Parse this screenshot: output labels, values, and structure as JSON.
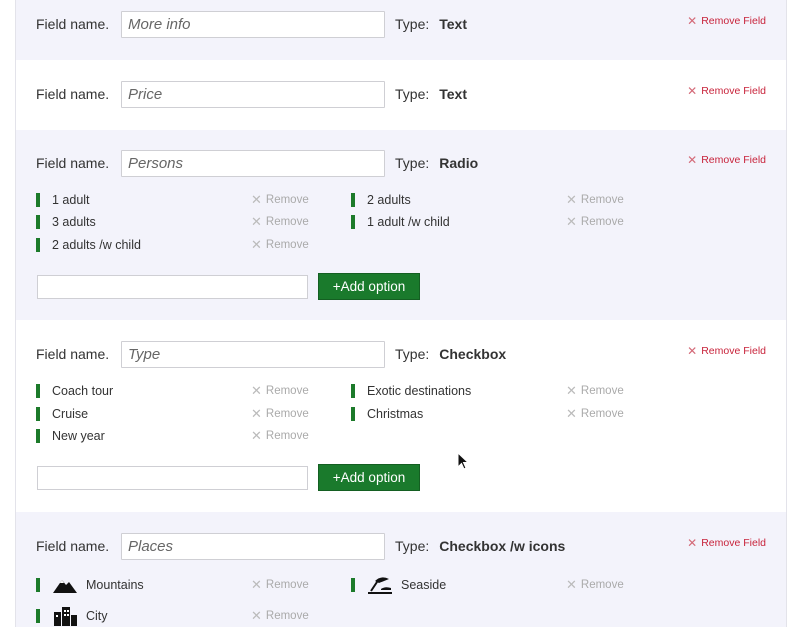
{
  "ui": {
    "field_name_label": "Field name.",
    "type_label": "Type:",
    "remove_field": "Remove Field",
    "remove": "Remove",
    "add_option": "+Add option"
  },
  "fields": [
    {
      "name": "More info",
      "type": "Text"
    },
    {
      "name": "Price",
      "type": "Text"
    },
    {
      "name": "Persons",
      "type": "Radio",
      "options": [
        "1 adult",
        "2 adults",
        "3 adults",
        "1 adult /w child",
        "2 adults /w child"
      ]
    },
    {
      "name": "Type",
      "type": "Checkbox",
      "options": [
        "Coach tour",
        "Exotic destinations",
        "Cruise",
        "Christmas",
        "New year"
      ]
    },
    {
      "name": "Places",
      "type": "Checkbox /w icons",
      "options": [
        {
          "label": "Mountains",
          "icon": "mountain-icon"
        },
        {
          "label": "Seaside",
          "icon": "seaside-icon"
        },
        {
          "label": "City",
          "icon": "city-icon"
        }
      ]
    }
  ],
  "colors": {
    "option_bar": "#1c7a2a",
    "add_button": "#1a7a2c",
    "remove_field": "#c8233b",
    "alt_background": "#f3f3fb"
  }
}
